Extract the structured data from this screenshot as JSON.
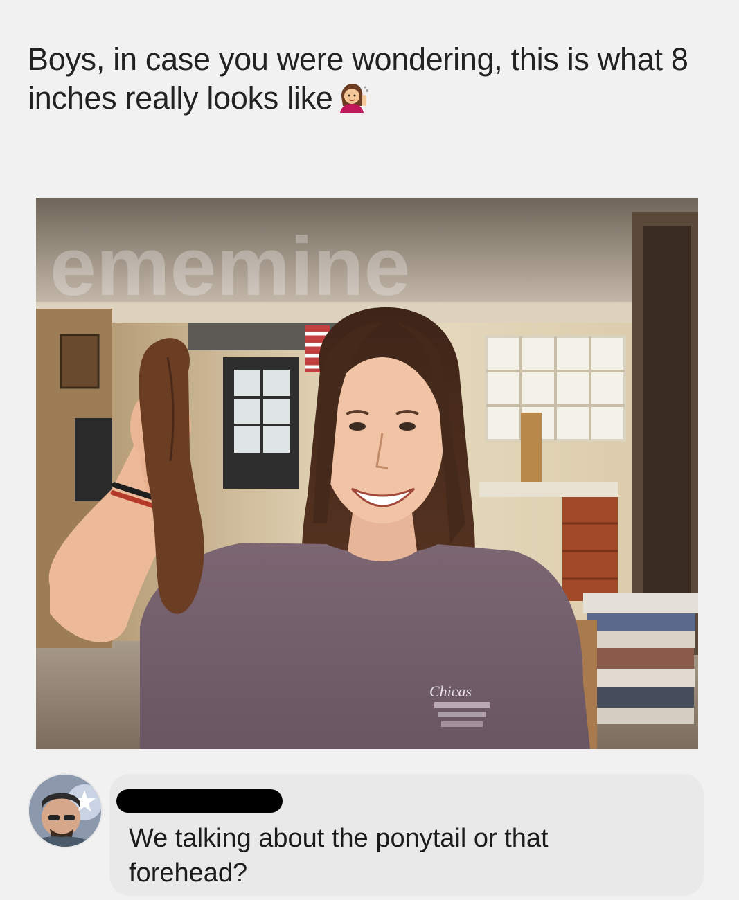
{
  "post": {
    "text": "Boys, in case you were wondering, this is what 8 inches really looks like",
    "emoji_icon": "woman-tipping-hand-emoji"
  },
  "photo": {
    "watermark": "ememine",
    "shirt_text": "Chicas"
  },
  "comment": {
    "text": "We talking about the ponytail or that forehead?",
    "name_redacted": true
  },
  "colors": {
    "background": "#f1f1f1",
    "comment_bubble": "#e9e9ea",
    "text": "#222222"
  }
}
